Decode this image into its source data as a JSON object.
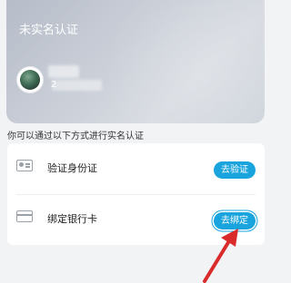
{
  "card": {
    "title": "未实名认证",
    "phone_visible": "2"
  },
  "hint": "你可以通过以下方式进行实名认证",
  "methods": [
    {
      "label": "验证身份证",
      "action": "去验证",
      "icon": "id-card-icon"
    },
    {
      "label": "绑定银行卡",
      "action": "去绑定",
      "icon": "bank-card-icon"
    }
  ],
  "colors": {
    "accent": "#1aa4dd",
    "arrow": "#d92b2b",
    "background": "#f2f3f5"
  }
}
